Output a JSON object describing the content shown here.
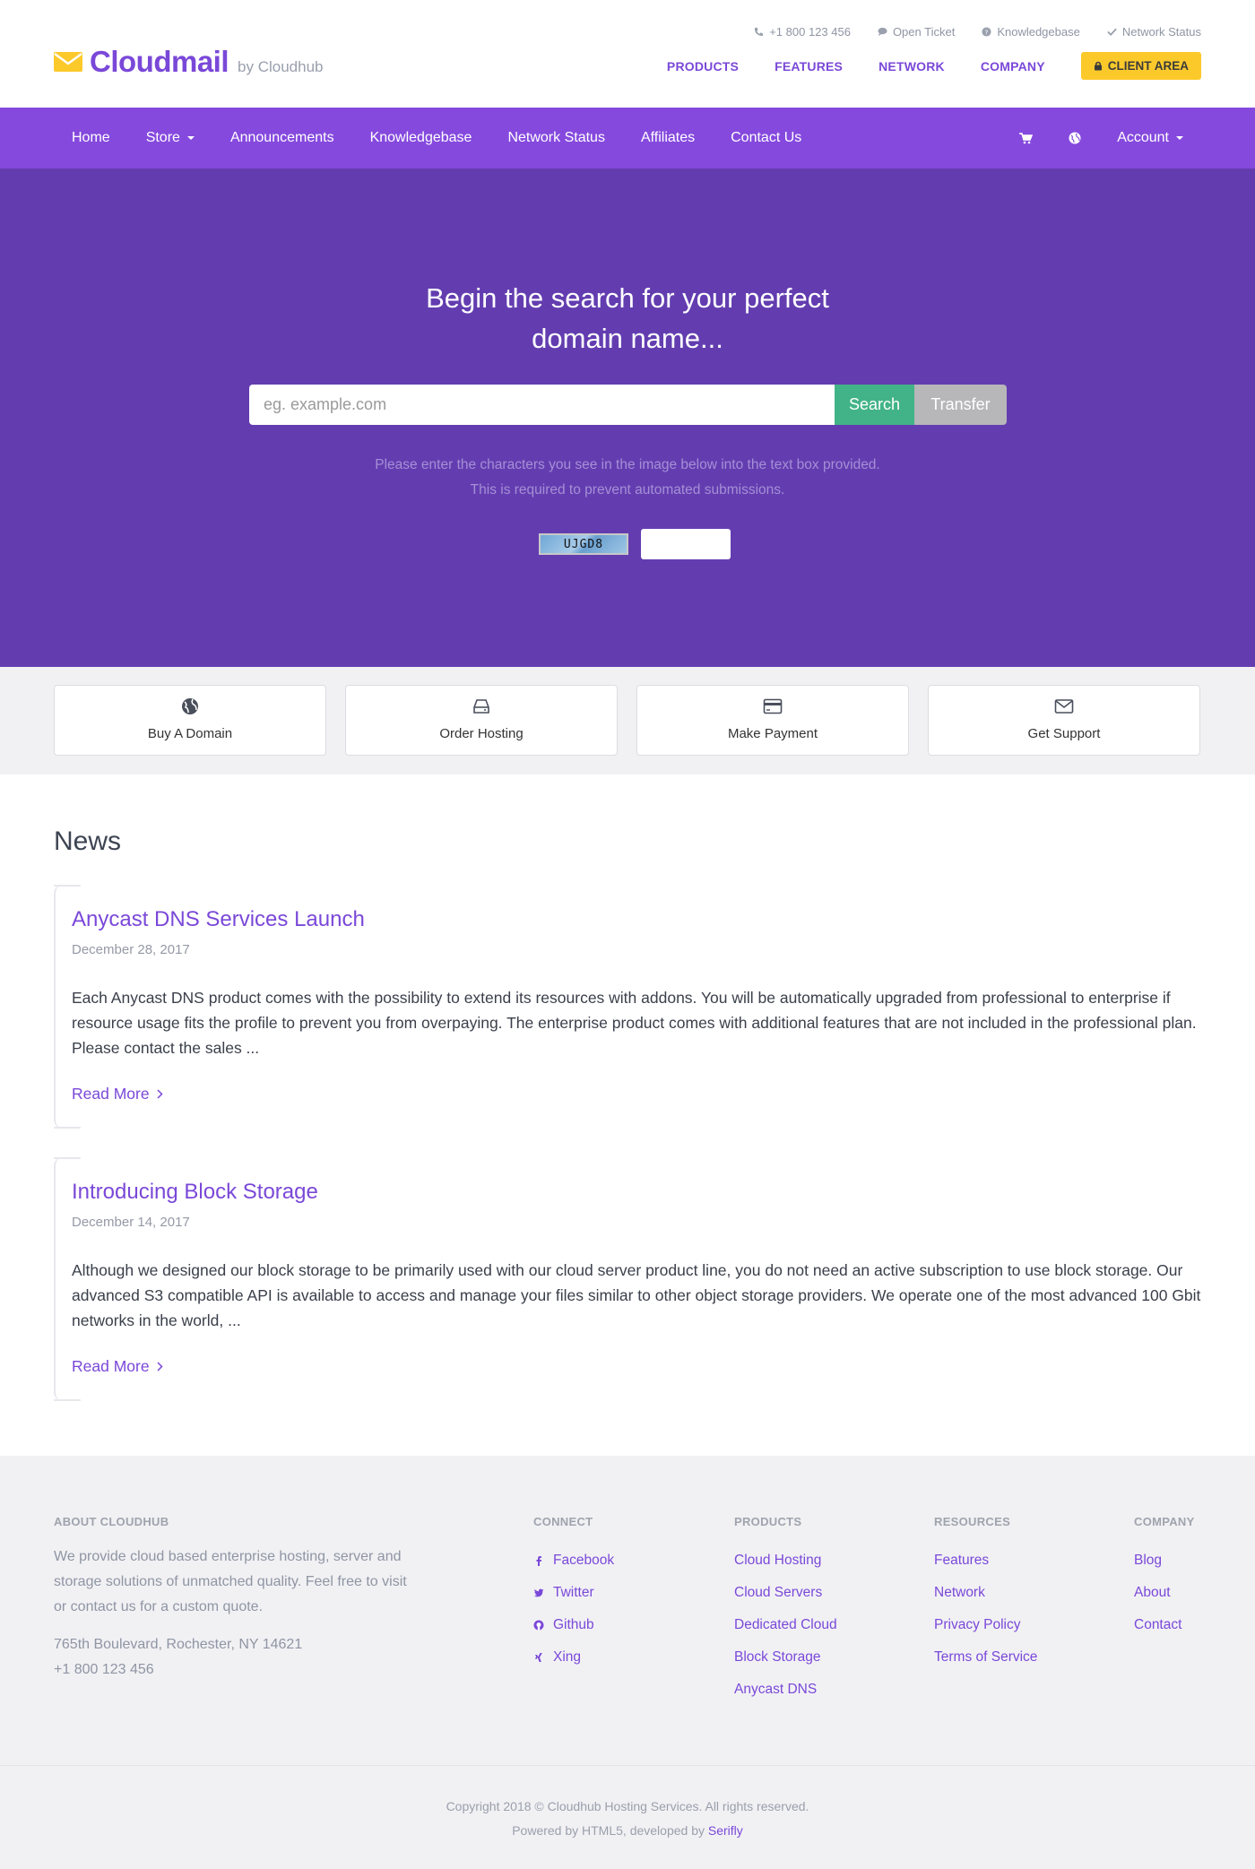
{
  "brand": {
    "name": "Cloudmail",
    "sub": "by Cloudhub",
    "accent": "#7a48d8",
    "yellow": "#fcc92b"
  },
  "utility": {
    "phone": "+1 800 123 456",
    "ticket": "Open Ticket",
    "kb": "Knowledgebase",
    "status": "Network Status"
  },
  "mainlinks": {
    "products": "PRODUCTS",
    "features": "FEATURES",
    "network": "NETWORK",
    "company": "COMPANY",
    "client_area": "CLIENT AREA"
  },
  "nav": {
    "home": "Home",
    "store": "Store",
    "announcements": "Announcements",
    "knowledgebase": "Knowledgebase",
    "network_status": "Network Status",
    "affiliates": "Affiliates",
    "contact": "Contact Us",
    "account": "Account"
  },
  "hero": {
    "title_line1": "Begin the search for your perfect",
    "title_line2": "domain name...",
    "placeholder": "eg. example.com",
    "search_btn": "Search",
    "transfer_btn": "Transfer",
    "hint_line1": "Please enter the characters you see in the image below into the text box provided.",
    "hint_line2": "This is required to prevent automated submissions.",
    "captcha_text": "UJGD8"
  },
  "actions": [
    {
      "label": "Buy A Domain",
      "icon": "globe-icon"
    },
    {
      "label": "Order Hosting",
      "icon": "hdd-icon"
    },
    {
      "label": "Make Payment",
      "icon": "credit-card-icon"
    },
    {
      "label": "Get Support",
      "icon": "envelope-icon"
    }
  ],
  "news": {
    "heading": "News",
    "posts": [
      {
        "title": "Anycast DNS Services Launch",
        "date": "December 28, 2017",
        "body": "Each Anycast DNS product comes with the possibility to extend its resources with addons. You will be automatically upgraded from professional to enterprise if resource usage fits the profile to prevent you from overpaying. The enterprise product comes with additional features that are not included in the professional plan. Please contact the sales ...",
        "more": "Read More"
      },
      {
        "title": "Introducing Block Storage",
        "date": "December 14, 2017",
        "body": "Although we designed our block storage to be primarily used with our cloud server product line, you do not need an active subscription to use block storage. Our advanced S3 compatible API is available to access and manage your files similar to other object storage providers. We operate one of the most advanced 100 Gbit networks in the world, ...",
        "more": "Read More"
      }
    ]
  },
  "footer": {
    "about_heading": "ABOUT CLOUDHUB",
    "about_text": "We provide cloud based enterprise hosting, server and storage solutions of unmatched quality. Feel free to visit or contact us for a custom quote.",
    "address": "765th Boulevard, Rochester, NY 14621",
    "phone": "+1 800 123 456",
    "connect_heading": "CONNECT",
    "connect": [
      "Facebook",
      "Twitter",
      "Github",
      "Xing"
    ],
    "products_heading": "PRODUCTS",
    "products": [
      "Cloud Hosting",
      "Cloud Servers",
      "Dedicated Cloud",
      "Block Storage",
      "Anycast DNS"
    ],
    "resources_heading": "RESOURCES",
    "resources": [
      "Features",
      "Network",
      "Privacy Policy",
      "Terms of Service"
    ],
    "company_heading": "COMPANY",
    "company": [
      "Blog",
      "About",
      "Contact"
    ]
  },
  "copyright": {
    "line1": "Copyright 2018 © Cloudhub Hosting Services. All rights reserved.",
    "line2_prefix": "Powered by HTML5, developed by ",
    "line2_link": "Serifly"
  }
}
